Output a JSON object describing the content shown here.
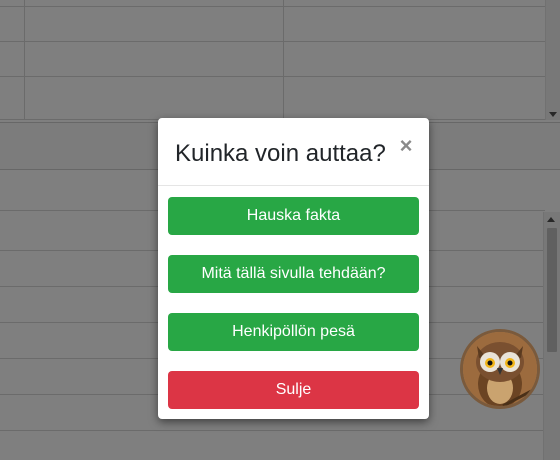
{
  "modal": {
    "title": "Kuinka voin auttaa?",
    "close_symbol": "×",
    "buttons": [
      {
        "label": "Hauska fakta",
        "color": "#28a745"
      },
      {
        "label": "Mitä tällä sivulla tehdään?",
        "color": "#28a745"
      },
      {
        "label": "Henkipöllön pesä",
        "color": "#28a745"
      },
      {
        "label": "Sulje",
        "color": "#dc3545"
      }
    ]
  },
  "avatar": {
    "icon": "owl-icon"
  },
  "icons": {
    "scroll_down": "arrow-down-icon",
    "scroll_up": "arrow-up-icon"
  },
  "colors": {
    "overlay": "rgba(0,0,0,0.5)",
    "accent_green": "#28a745",
    "danger_red": "#dc3545"
  }
}
